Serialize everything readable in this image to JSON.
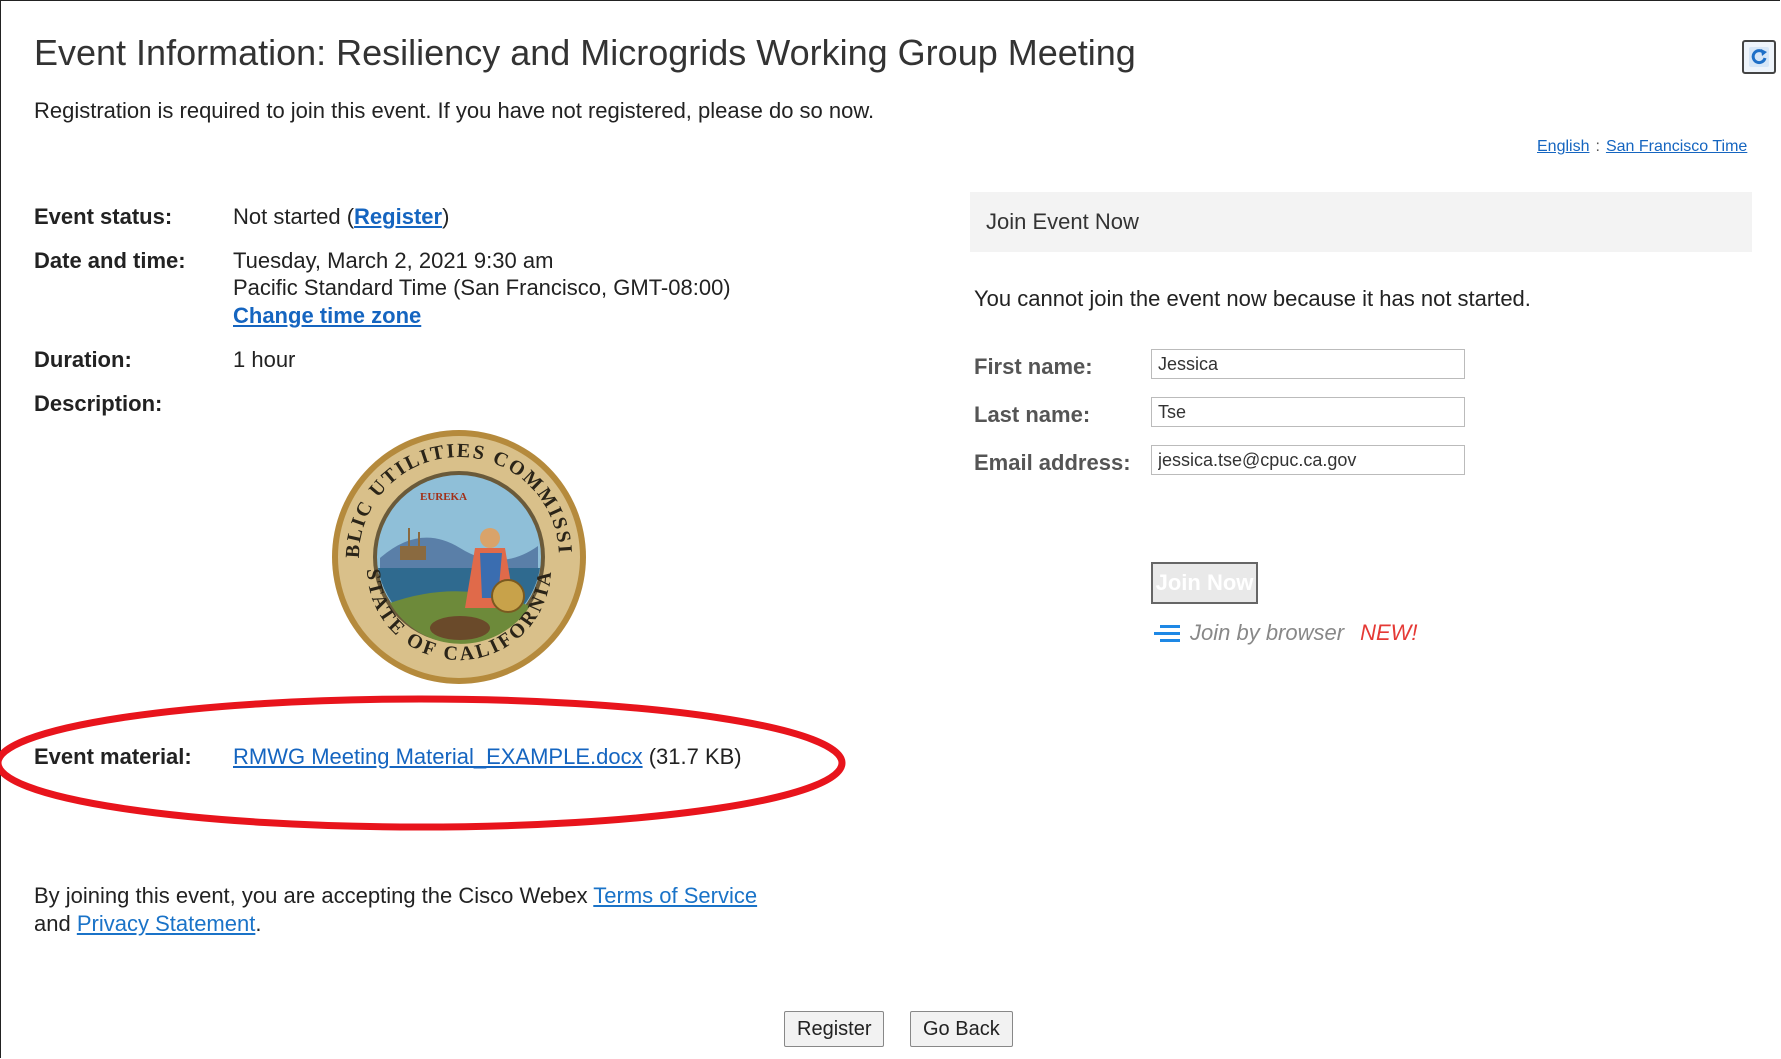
{
  "page": {
    "title": "Event Information: Resiliency and Microgrids Working Group Meeting",
    "notice": "Registration is required to join this event. If you have not registered, please do so now."
  },
  "locale": {
    "language": "English",
    "separator": ":",
    "timezone": "San Francisco Time"
  },
  "event": {
    "status_label": "Event status:",
    "status_value": "Not started (",
    "status_link": "Register",
    "status_close": ")",
    "date_label": "Date and time:",
    "date_line1": "Tuesday, March 2, 2021 9:30 am",
    "date_line2": "Pacific Standard Time (San Francisco, GMT-08:00)",
    "change_tz": "Change time zone",
    "duration_label": "Duration:",
    "duration_value": "1 hour",
    "description_label": "Description:",
    "seal": {
      "top_text": "PUBLIC UTILITIES COMMISSION",
      "bottom_text": "STATE OF CALIFORNIA",
      "motto": "EUREKA"
    },
    "material_label": "Event material:",
    "material_file": "RMWG Meeting Material_EXAMPLE.docx",
    "material_size": "(31.7 KB)"
  },
  "legal": {
    "prefix": "By joining this event, you are accepting the Cisco Webex ",
    "terms": "Terms of Service",
    "and": " and ",
    "privacy": "Privacy Statement",
    "suffix": "."
  },
  "join": {
    "header": "Join Event Now",
    "message": "You cannot join the event now because it has not started.",
    "first_name_label": "First name:",
    "first_name_value": "Jessica",
    "last_name_label": "Last name:",
    "last_name_value": "Tse",
    "email_label": "Email address:",
    "email_value": "jessica.tse@cpuc.ca.gov",
    "join_now": "Join Now",
    "browser_text": "Join by browser",
    "new_badge": "NEW!"
  },
  "actions": {
    "register": "Register",
    "go_back": "Go Back"
  },
  "colors": {
    "link": "#1565c0",
    "annotation": "#e8141c",
    "new_badge": "#e53935",
    "browser_icon": "#1e88e5"
  },
  "icons": [
    "refresh-icon",
    "browser-lines-icon",
    "cpuc-seal-logo"
  ]
}
